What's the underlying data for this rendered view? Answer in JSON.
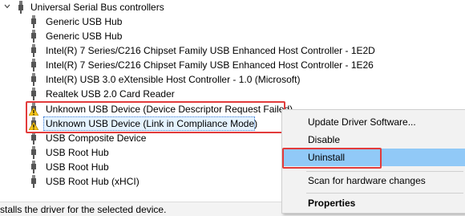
{
  "tree": {
    "group_label": "Universal Serial Bus controllers",
    "items": [
      {
        "label": "Generic USB Hub",
        "icon": "usb-device-icon"
      },
      {
        "label": "Generic USB Hub",
        "icon": "usb-device-icon"
      },
      {
        "label": "Intel(R) 7 Series/C216 Chipset Family USB Enhanced Host Controller - 1E2D",
        "icon": "usb-device-icon"
      },
      {
        "label": "Intel(R) 7 Series/C216 Chipset Family USB Enhanced Host Controller - 1E26",
        "icon": "usb-device-icon"
      },
      {
        "label": "Intel(R) USB 3.0 eXtensible Host Controller - 1.0 (Microsoft)",
        "icon": "usb-device-icon"
      },
      {
        "label": "Realtek USB 2.0 Card Reader",
        "icon": "usb-device-icon"
      },
      {
        "label": "Unknown USB Device (Device Descriptor Request Failed)",
        "icon": "warning-device-icon"
      },
      {
        "label": "Unknown USB Device (Link in Compliance Mode)",
        "icon": "warning-device-icon"
      },
      {
        "label": "USB Composite Device",
        "icon": "usb-device-icon"
      },
      {
        "label": "USB Root Hub",
        "icon": "usb-device-icon"
      },
      {
        "label": "USB Root Hub",
        "icon": "usb-device-icon"
      },
      {
        "label": "USB Root Hub (xHCI)",
        "icon": "usb-device-icon"
      }
    ]
  },
  "status_bar": {
    "text": "stalls the driver for the selected device."
  },
  "context_menu": {
    "items": [
      {
        "label": "Update Driver Software..."
      },
      {
        "label": "Disable"
      },
      {
        "label": "Uninstall"
      },
      {
        "label": "Scan for hardware changes"
      },
      {
        "label": "Properties"
      }
    ]
  },
  "colors": {
    "highlight_box": "#e23b3b",
    "menu_hover": "#91c9f7",
    "selection_bg": "#e5f3ff"
  }
}
